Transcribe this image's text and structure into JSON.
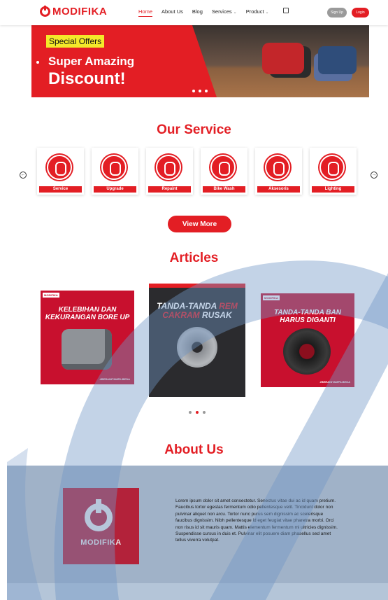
{
  "brand": {
    "name": "MODIFIKA"
  },
  "nav": {
    "items": [
      {
        "label": "Home"
      },
      {
        "label": "About Us"
      },
      {
        "label": "Blog"
      },
      {
        "label": "Services"
      },
      {
        "label": "Product"
      }
    ],
    "signup": "Sign Up",
    "login": "Login"
  },
  "hero": {
    "badge": "Special Offers",
    "line1": "Super Amazing",
    "line2": "Discount!"
  },
  "services": {
    "title": "Our Service",
    "items": [
      {
        "label": "Service"
      },
      {
        "label": "Upgrade"
      },
      {
        "label": "Repaint"
      },
      {
        "label": "Bike Wash"
      },
      {
        "label": "Aksesoris"
      },
      {
        "label": "Lighting"
      }
    ],
    "view_more": "View More"
  },
  "articles": {
    "title": "Articles",
    "items": [
      {
        "title": "KELEBIHAN DAN KEKURANGAN BORE UP",
        "hashtag": "#BERANITAMPILBEDA"
      },
      {
        "title_a": "TANDA-TANDA",
        "title_b": "REM",
        "title_c": "CAKRAM",
        "title_d": "RUSAK"
      },
      {
        "title": "TANDA-TANDA BAN HARUS DIGANTI",
        "hashtag": "#BERANITAMPILBEDA"
      }
    ]
  },
  "about": {
    "title": "About Us",
    "logo_text": "MODIFIKA",
    "body": "Lorem ipsum dolor sit amet consectetur. Senectus vitae dui ac id quam pretium. Faucibus tortor egestas fermentum odio pellentesque velit. Tincidunt dolor non pulvinar aliquet non arcu. Tortor nunc purus sem dignissim ac scelerisque faucibus dignissim. Nibh pellentesque id eget feugiat vitae pharetra morbi. Orci non risus id sit mauris quam. Mattis elementum fermentum mi ultricies dignissim. Suspendisse cursus in duis et. Pulvinar elit posuere diam phasellus sed amet tellus viverra volutpat."
  },
  "colors": {
    "accent": "#e31e24",
    "watermark": "#6f96c6"
  }
}
